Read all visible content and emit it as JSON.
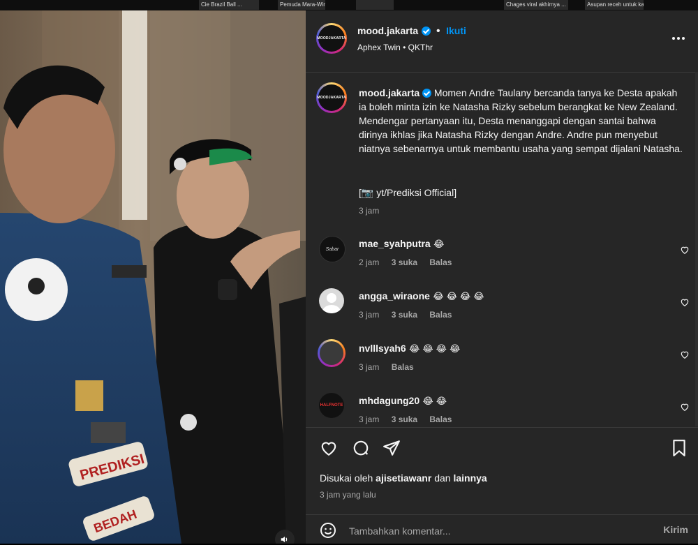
{
  "top_strip": {
    "thumbs": [
      "Cie Brazil Ball ...",
      "Pemuda Mara-Win...",
      "",
      "Chages viral akhirnya ...",
      "Asupan receh untuk kalian..."
    ]
  },
  "post": {
    "account": "mood.jakarta",
    "avatar_text": "MOODJAKARTA",
    "follow_label": "Ikuti",
    "bullet": "•",
    "audio": "Aphex Twin • QKThr",
    "more_icon": "more-horizontal-icon",
    "caption": {
      "username": "mood.jakarta",
      "text": "Momen Andre Taulany bercanda tanya ke Desta apakah ia boleh minta izin ke Natasha Rizky sebelum berangkat ke New Zealand. Mendengar pertanyaan itu, Desta menanggapi dengan santai bahwa dirinya ikhlas jika Natasha Rizky dengan Andre. Andre pun menyebut niatnya sebenarnya untuk membantu usaha yang sempat dijalani Natasha.",
      "credit": "[📷 yt/Prediksi Official]",
      "time": "3 jam"
    },
    "comments": [
      {
        "user": "mae_syahputra",
        "text": "😂",
        "time": "2 jam",
        "likes": "3 suka",
        "reply": "Balas",
        "avatar_text": "Sabar"
      },
      {
        "user": "angga_wiraone",
        "text": "😂 😂 😂 😂",
        "time": "3 jam",
        "likes": "3 suka",
        "reply": "Balas",
        "avatar_text": ""
      },
      {
        "user": "nvlllsyah6",
        "text": "😂 😂 😂 😂",
        "time": "3 jam",
        "likes": "",
        "reply": "Balas",
        "avatar_text": ""
      },
      {
        "user": "mhdagung20",
        "text": "😂 😂",
        "time": "3 jam",
        "likes": "3 suka",
        "reply": "Balas",
        "avatar_text": "HALFNOTE"
      }
    ],
    "liked_by_prefix": "Disukai oleh",
    "liked_by_user": "ajisetiawanr",
    "liked_by_and": "dan",
    "liked_by_others": "lainnya",
    "posted_time": "3 jam yang lalu",
    "comment_placeholder": "Tambahkan komentar...",
    "send_label": "Kirim"
  },
  "colors": {
    "panel_bg": "#262626",
    "accent": "#0095f6",
    "text": "#f5f5f5",
    "muted": "#a8a8a8"
  }
}
